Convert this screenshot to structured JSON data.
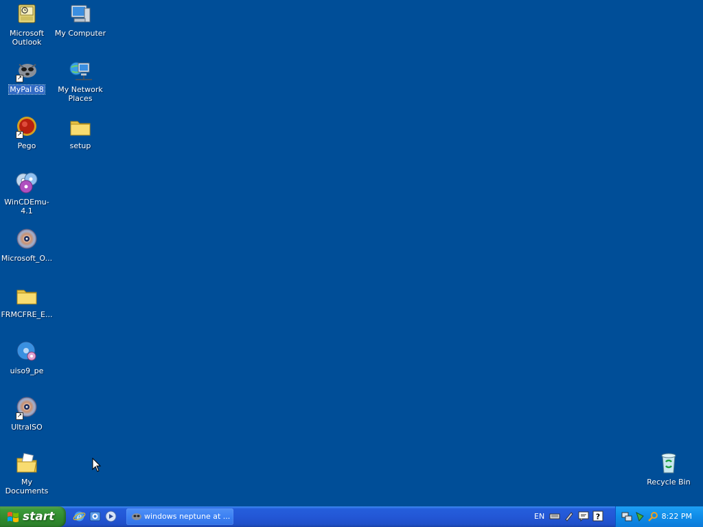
{
  "desktop": {
    "background_color": "#004e98",
    "icons": [
      {
        "label": "Microsoft Outlook",
        "icon": "outlook-icon"
      },
      {
        "label": "My Computer",
        "icon": "my-computer-icon"
      },
      {
        "label": "MyPal 68",
        "icon": "mypal-icon",
        "selected": true,
        "shortcut": true
      },
      {
        "label": "My Network Places",
        "icon": "network-places-icon"
      },
      {
        "label": "Pego",
        "icon": "pego-icon",
        "shortcut": true
      },
      {
        "label": "setup",
        "icon": "folder-icon"
      },
      {
        "label": "WinCDEmu-4.1",
        "icon": "wincdemu-icon"
      },
      {
        "label": "Microsoft_O...",
        "icon": "disc-image-icon"
      },
      {
        "label": "FRMCFRE_E...",
        "icon": "folder-icon"
      },
      {
        "label": "uiso9_pe",
        "icon": "uiso-installer-icon"
      },
      {
        "label": "UltraISO",
        "icon": "ultraiso-icon",
        "shortcut": true
      },
      {
        "label": "My Documents",
        "icon": "my-documents-icon"
      },
      {
        "label": "Recycle Bin",
        "icon": "recycle-bin-icon"
      }
    ]
  },
  "taskbar": {
    "start_label": "start",
    "quick_launch": [
      "internet-explorer-icon",
      "outlook-express-icon",
      "media-player-icon"
    ],
    "task_button_label": "windows neptune at ...",
    "language": "EN",
    "clock": "8:22 PM"
  }
}
